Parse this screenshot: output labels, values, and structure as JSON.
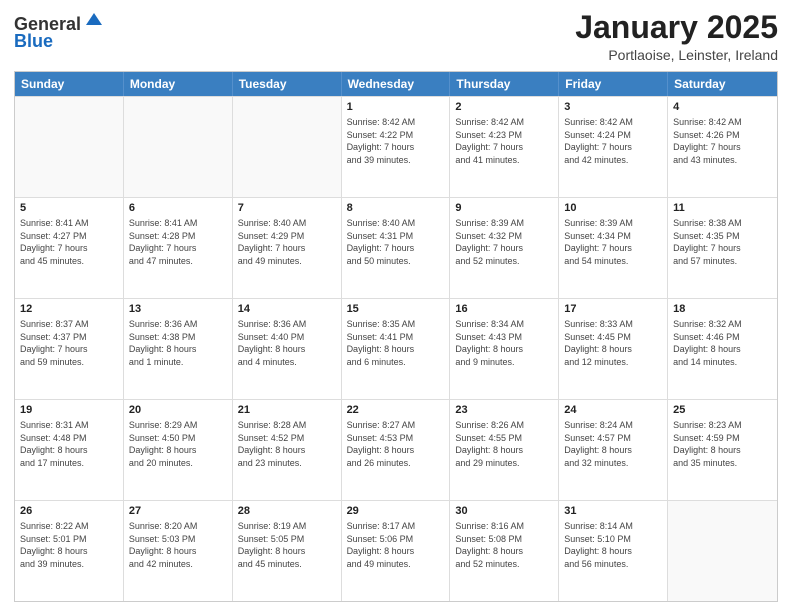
{
  "header": {
    "logo_line1": "General",
    "logo_line2": "Blue",
    "month_title": "January 2025",
    "subtitle": "Portlaoise, Leinster, Ireland"
  },
  "weekdays": [
    "Sunday",
    "Monday",
    "Tuesday",
    "Wednesday",
    "Thursday",
    "Friday",
    "Saturday"
  ],
  "weeks": [
    [
      {
        "day": "",
        "info": ""
      },
      {
        "day": "",
        "info": ""
      },
      {
        "day": "",
        "info": ""
      },
      {
        "day": "1",
        "info": "Sunrise: 8:42 AM\nSunset: 4:22 PM\nDaylight: 7 hours\nand 39 minutes."
      },
      {
        "day": "2",
        "info": "Sunrise: 8:42 AM\nSunset: 4:23 PM\nDaylight: 7 hours\nand 41 minutes."
      },
      {
        "day": "3",
        "info": "Sunrise: 8:42 AM\nSunset: 4:24 PM\nDaylight: 7 hours\nand 42 minutes."
      },
      {
        "day": "4",
        "info": "Sunrise: 8:42 AM\nSunset: 4:26 PM\nDaylight: 7 hours\nand 43 minutes."
      }
    ],
    [
      {
        "day": "5",
        "info": "Sunrise: 8:41 AM\nSunset: 4:27 PM\nDaylight: 7 hours\nand 45 minutes."
      },
      {
        "day": "6",
        "info": "Sunrise: 8:41 AM\nSunset: 4:28 PM\nDaylight: 7 hours\nand 47 minutes."
      },
      {
        "day": "7",
        "info": "Sunrise: 8:40 AM\nSunset: 4:29 PM\nDaylight: 7 hours\nand 49 minutes."
      },
      {
        "day": "8",
        "info": "Sunrise: 8:40 AM\nSunset: 4:31 PM\nDaylight: 7 hours\nand 50 minutes."
      },
      {
        "day": "9",
        "info": "Sunrise: 8:39 AM\nSunset: 4:32 PM\nDaylight: 7 hours\nand 52 minutes."
      },
      {
        "day": "10",
        "info": "Sunrise: 8:39 AM\nSunset: 4:34 PM\nDaylight: 7 hours\nand 54 minutes."
      },
      {
        "day": "11",
        "info": "Sunrise: 8:38 AM\nSunset: 4:35 PM\nDaylight: 7 hours\nand 57 minutes."
      }
    ],
    [
      {
        "day": "12",
        "info": "Sunrise: 8:37 AM\nSunset: 4:37 PM\nDaylight: 7 hours\nand 59 minutes."
      },
      {
        "day": "13",
        "info": "Sunrise: 8:36 AM\nSunset: 4:38 PM\nDaylight: 8 hours\nand 1 minute."
      },
      {
        "day": "14",
        "info": "Sunrise: 8:36 AM\nSunset: 4:40 PM\nDaylight: 8 hours\nand 4 minutes."
      },
      {
        "day": "15",
        "info": "Sunrise: 8:35 AM\nSunset: 4:41 PM\nDaylight: 8 hours\nand 6 minutes."
      },
      {
        "day": "16",
        "info": "Sunrise: 8:34 AM\nSunset: 4:43 PM\nDaylight: 8 hours\nand 9 minutes."
      },
      {
        "day": "17",
        "info": "Sunrise: 8:33 AM\nSunset: 4:45 PM\nDaylight: 8 hours\nand 12 minutes."
      },
      {
        "day": "18",
        "info": "Sunrise: 8:32 AM\nSunset: 4:46 PM\nDaylight: 8 hours\nand 14 minutes."
      }
    ],
    [
      {
        "day": "19",
        "info": "Sunrise: 8:31 AM\nSunset: 4:48 PM\nDaylight: 8 hours\nand 17 minutes."
      },
      {
        "day": "20",
        "info": "Sunrise: 8:29 AM\nSunset: 4:50 PM\nDaylight: 8 hours\nand 20 minutes."
      },
      {
        "day": "21",
        "info": "Sunrise: 8:28 AM\nSunset: 4:52 PM\nDaylight: 8 hours\nand 23 minutes."
      },
      {
        "day": "22",
        "info": "Sunrise: 8:27 AM\nSunset: 4:53 PM\nDaylight: 8 hours\nand 26 minutes."
      },
      {
        "day": "23",
        "info": "Sunrise: 8:26 AM\nSunset: 4:55 PM\nDaylight: 8 hours\nand 29 minutes."
      },
      {
        "day": "24",
        "info": "Sunrise: 8:24 AM\nSunset: 4:57 PM\nDaylight: 8 hours\nand 32 minutes."
      },
      {
        "day": "25",
        "info": "Sunrise: 8:23 AM\nSunset: 4:59 PM\nDaylight: 8 hours\nand 35 minutes."
      }
    ],
    [
      {
        "day": "26",
        "info": "Sunrise: 8:22 AM\nSunset: 5:01 PM\nDaylight: 8 hours\nand 39 minutes."
      },
      {
        "day": "27",
        "info": "Sunrise: 8:20 AM\nSunset: 5:03 PM\nDaylight: 8 hours\nand 42 minutes."
      },
      {
        "day": "28",
        "info": "Sunrise: 8:19 AM\nSunset: 5:05 PM\nDaylight: 8 hours\nand 45 minutes."
      },
      {
        "day": "29",
        "info": "Sunrise: 8:17 AM\nSunset: 5:06 PM\nDaylight: 8 hours\nand 49 minutes."
      },
      {
        "day": "30",
        "info": "Sunrise: 8:16 AM\nSunset: 5:08 PM\nDaylight: 8 hours\nand 52 minutes."
      },
      {
        "day": "31",
        "info": "Sunrise: 8:14 AM\nSunset: 5:10 PM\nDaylight: 8 hours\nand 56 minutes."
      },
      {
        "day": "",
        "info": ""
      }
    ]
  ]
}
